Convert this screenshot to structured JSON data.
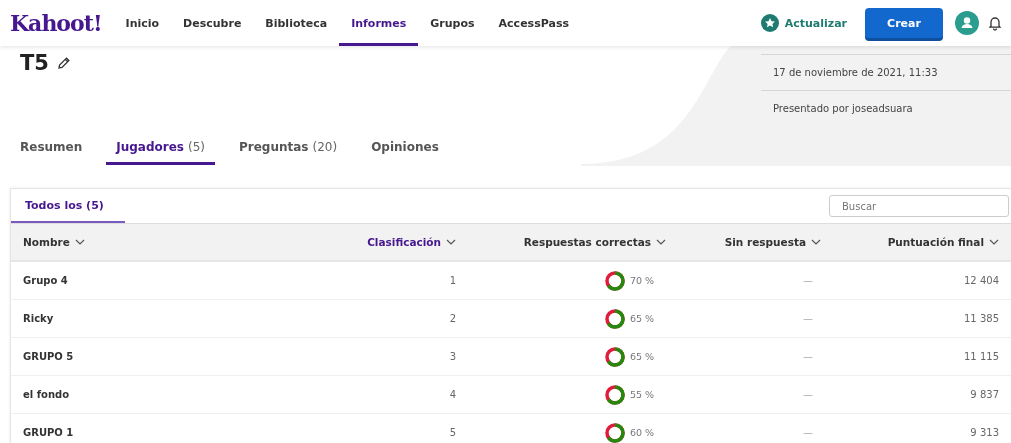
{
  "nav": {
    "logo": "Kahoot!",
    "items": [
      {
        "label": "Inicio",
        "selected": false
      },
      {
        "label": "Descubre",
        "selected": false
      },
      {
        "label": "Biblioteca",
        "selected": false
      },
      {
        "label": "Informes",
        "selected": true
      },
      {
        "label": "Grupos",
        "selected": false
      },
      {
        "label": "AccessPass",
        "selected": false
      }
    ],
    "upgrade": "Actualizar",
    "create": "Crear"
  },
  "report": {
    "title": "T5",
    "date": "17 de noviembre de 2021, 11:33",
    "presenter": "Presentado por joseadsuara"
  },
  "tabs": [
    {
      "label": "Resumen",
      "selected": false
    },
    {
      "label": "Jugadores",
      "count": "(5)",
      "selected": true
    },
    {
      "label": "Preguntas",
      "count": "(20)",
      "selected": false
    },
    {
      "label": "Opiniones",
      "selected": false
    }
  ],
  "filter": {
    "label": "Todos los (5)",
    "selected": true
  },
  "search": {
    "placeholder": "Buscar"
  },
  "table": {
    "columns": [
      {
        "label": "Nombre",
        "selected": false
      },
      {
        "label": "Clasificación",
        "selected": true
      },
      {
        "label": "Respuestas correctas",
        "selected": false
      },
      {
        "label": "Sin respuesta",
        "selected": false
      },
      {
        "label": "Puntuación final",
        "selected": false
      }
    ],
    "rows": [
      {
        "name": "Grupo 4",
        "rank": "1",
        "percent": "70 %",
        "unanswered": "—",
        "score": "12 404"
      },
      {
        "name": "Ricky",
        "rank": "2",
        "percent": "65 %",
        "unanswered": "—",
        "score": "11 385"
      },
      {
        "name": "GRUPO 5",
        "rank": "3",
        "percent": "65 %",
        "unanswered": "—",
        "score": "11 115"
      },
      {
        "name": "el fondo",
        "rank": "4",
        "percent": "55 %",
        "unanswered": "—",
        "score": "9 837"
      },
      {
        "name": "GRUPO 1",
        "rank": "5",
        "percent": "60 %",
        "unanswered": "—",
        "score": "9 313"
      }
    ]
  }
}
